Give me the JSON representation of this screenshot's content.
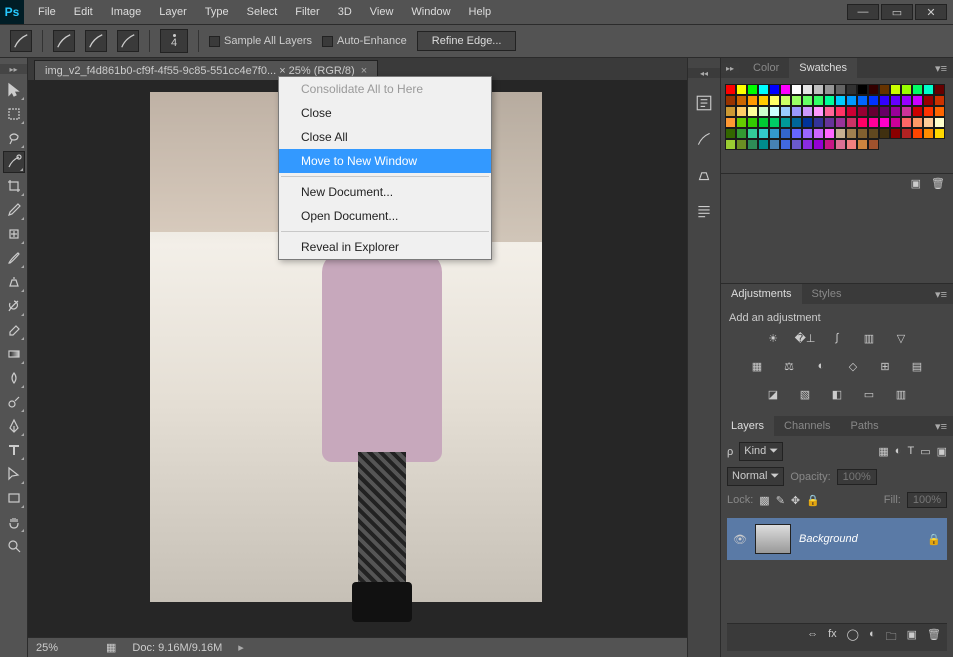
{
  "app": {
    "logo_text": "Ps"
  },
  "menubar": [
    "File",
    "Edit",
    "Image",
    "Layer",
    "Type",
    "Select",
    "Filter",
    "3D",
    "View",
    "Window",
    "Help"
  ],
  "window_controls": {
    "min": "—",
    "max": "▭",
    "close": "✕"
  },
  "options_bar": {
    "brush_size": "4",
    "sample_all_layers": "Sample All Layers",
    "auto_enhance": "Auto-Enhance",
    "refine_edge": "Refine Edge..."
  },
  "doc_tab": {
    "name": "img_v2_f4d861b0-cf9f-4f55-9c85-551cc4e7f0... × 25% (RGR/8)",
    "close": "×"
  },
  "context_menu": {
    "items": [
      {
        "label": "Consolidate All to Here",
        "disabled": true
      },
      {
        "label": "Close"
      },
      {
        "label": "Close All"
      },
      {
        "label": "Move to New Window",
        "selected": true
      },
      {
        "sep": true
      },
      {
        "label": "New Document..."
      },
      {
        "label": "Open Document..."
      },
      {
        "sep": true
      },
      {
        "label": "Reveal in Explorer"
      }
    ]
  },
  "status": {
    "zoom": "25%",
    "doc": "Doc: 9.16M/9.16M"
  },
  "panels": {
    "color_tab": "Color",
    "swatches_tab": "Swatches",
    "adjustments_tab": "Adjustments",
    "styles_tab": "Styles",
    "add_adjustment": "Add an adjustment",
    "layers_tab": "Layers",
    "channels_tab": "Channels",
    "paths_tab": "Paths",
    "kind_label": "Kind",
    "blend_mode": "Normal",
    "opacity_label": "Opacity:",
    "opacity_value": "100%",
    "lock_label": "Lock:",
    "fill_label": "Fill:",
    "fill_value": "100%",
    "layer_name": "Background"
  },
  "swatch_colors": [
    "#ff0000",
    "#ffff00",
    "#00ff00",
    "#00ffff",
    "#0000ff",
    "#ff00ff",
    "#ffffff",
    "#e4e4e4",
    "#c0c0c0",
    "#969696",
    "#646464",
    "#323232",
    "#000000",
    "#330000",
    "#663300",
    "#ccff00",
    "#99ff00",
    "#00ff66",
    "#00ffcc",
    "#660000",
    "#993300",
    "#cc6600",
    "#ff9900",
    "#ffcc00",
    "#ffff66",
    "#ccff66",
    "#99ff66",
    "#66ff66",
    "#33ff66",
    "#00ff99",
    "#00ccff",
    "#0099ff",
    "#0066ff",
    "#0033ff",
    "#3300ff",
    "#6600ff",
    "#9900ff",
    "#cc00ff",
    "#990000",
    "#cc3300",
    "#cc9933",
    "#ffcc66",
    "#ffff99",
    "#ccffcc",
    "#ccffff",
    "#99ccff",
    "#9999ff",
    "#cc99ff",
    "#ff99ff",
    "#ff6699",
    "#ff3366",
    "#cc0033",
    "#990033",
    "#660033",
    "#660066",
    "#990099",
    "#cc3399",
    "#cc0000",
    "#ff3300",
    "#ff6600",
    "#ff9933",
    "#66cc00",
    "#33cc00",
    "#00cc33",
    "#00cc66",
    "#009999",
    "#006699",
    "#003399",
    "#333399",
    "#663399",
    "#993399",
    "#cc3366",
    "#ff0066",
    "#ff0099",
    "#ff00cc",
    "#cc0099",
    "#ff6666",
    "#ff9966",
    "#ffcc99",
    "#ffffcc",
    "#336600",
    "#339933",
    "#33cc99",
    "#33cccc",
    "#3399cc",
    "#3366cc",
    "#6666ff",
    "#9966ff",
    "#cc66ff",
    "#ff66ff",
    "#c6b091",
    "#a08050",
    "#806030",
    "#604820",
    "#403010",
    "#8b0000",
    "#b22222",
    "#ff4500",
    "#ff8c00",
    "#ffd700",
    "#9acd32",
    "#6b8e23",
    "#2e8b57",
    "#008b8b",
    "#4682b4",
    "#4169e1",
    "#6a5acd",
    "#8a2be2",
    "#9400d3",
    "#c71585",
    "#db7093",
    "#f08080",
    "#cd853f",
    "#a0522d"
  ],
  "tools": [
    "move-tool",
    "rectangular-marquee-tool",
    "lasso-tool",
    "quick-selection-tool",
    "crop-tool",
    "eyedropper-tool",
    "spot-healing-tool",
    "brush-tool",
    "clone-stamp-tool",
    "history-brush-tool",
    "eraser-tool",
    "gradient-tool",
    "blur-tool",
    "dodge-tool",
    "pen-tool",
    "type-tool",
    "path-selection-tool",
    "rectangle-tool",
    "hand-tool",
    "zoom-tool"
  ],
  "strip_icons": [
    "history-icon",
    "brush-preset-icon",
    "clone-source-icon",
    "paragraph-icon"
  ],
  "adjustment_icons_row1": [
    "brightness-icon",
    "levels-icon",
    "curves-icon",
    "exposure-icon",
    "vibrance-icon"
  ],
  "adjustment_icons_row2": [
    "hue-icon",
    "balance-icon",
    "bw-icon",
    "photo-filter-icon",
    "channel-mixer-icon",
    "lut-icon"
  ],
  "adjustment_icons_row3": [
    "invert-icon",
    "posterize-icon",
    "threshold-icon",
    "map-icon",
    "selective-icon"
  ]
}
